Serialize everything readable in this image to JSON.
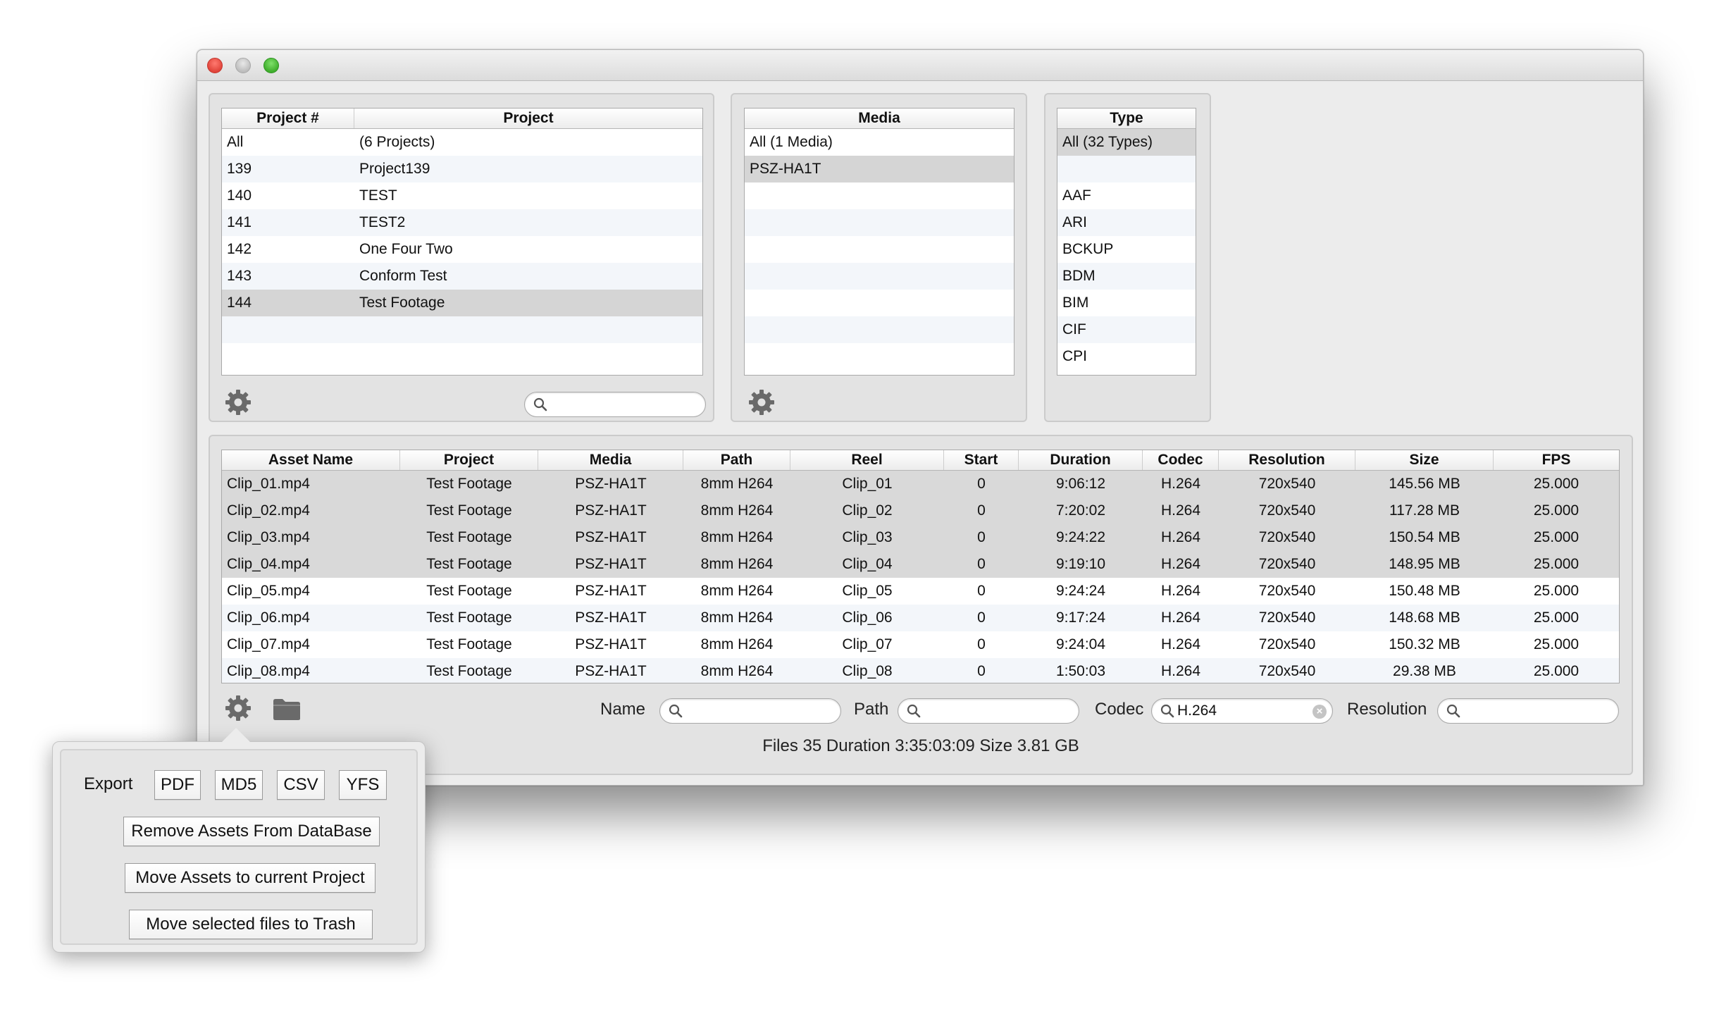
{
  "projects": {
    "columns": [
      "Project #",
      "Project"
    ],
    "rows": [
      {
        "num": "All",
        "name": "(6 Projects)"
      },
      {
        "num": "139",
        "name": "Project139"
      },
      {
        "num": "140",
        "name": "TEST"
      },
      {
        "num": "141",
        "name": "TEST2"
      },
      {
        "num": "142",
        "name": "One Four Two"
      },
      {
        "num": "143",
        "name": "Conform Test"
      },
      {
        "num": "144",
        "name": "Test Footage"
      }
    ],
    "selected_index": 6,
    "search_placeholder": ""
  },
  "media": {
    "column": "Media",
    "rows": [
      "All (1 Media)",
      "PSZ-HA1T"
    ],
    "selected_index": 1
  },
  "types": {
    "column": "Type",
    "rows": [
      "All (32 Types)",
      "",
      "AAF",
      "ARI",
      "BCKUP",
      "BDM",
      "BIM",
      "CIF",
      "CPI"
    ],
    "selected_index": 0
  },
  "assets": {
    "columns": [
      "Asset Name",
      "Project",
      "Media",
      "Path",
      "Reel",
      "Start",
      "Duration",
      "Codec",
      "Resolution",
      "Size",
      "FPS"
    ],
    "rows": [
      [
        "Clip_01.mp4",
        "Test Footage",
        "PSZ-HA1T",
        "8mm H264",
        "Clip_01",
        "0",
        "9:06:12",
        "H.264",
        "720x540",
        "145.56 MB",
        "25.000"
      ],
      [
        "Clip_02.mp4",
        "Test Footage",
        "PSZ-HA1T",
        "8mm H264",
        "Clip_02",
        "0",
        "7:20:02",
        "H.264",
        "720x540",
        "117.28 MB",
        "25.000"
      ],
      [
        "Clip_03.mp4",
        "Test Footage",
        "PSZ-HA1T",
        "8mm H264",
        "Clip_03",
        "0",
        "9:24:22",
        "H.264",
        "720x540",
        "150.54 MB",
        "25.000"
      ],
      [
        "Clip_04.mp4",
        "Test Footage",
        "PSZ-HA1T",
        "8mm H264",
        "Clip_04",
        "0",
        "9:19:10",
        "H.264",
        "720x540",
        "148.95 MB",
        "25.000"
      ],
      [
        "Clip_05.mp4",
        "Test Footage",
        "PSZ-HA1T",
        "8mm H264",
        "Clip_05",
        "0",
        "9:24:24",
        "H.264",
        "720x540",
        "150.48 MB",
        "25.000"
      ],
      [
        "Clip_06.mp4",
        "Test Footage",
        "PSZ-HA1T",
        "8mm H264",
        "Clip_06",
        "0",
        "9:17:24",
        "H.264",
        "720x540",
        "148.68 MB",
        "25.000"
      ],
      [
        "Clip_07.mp4",
        "Test Footage",
        "PSZ-HA1T",
        "8mm H264",
        "Clip_07",
        "0",
        "9:24:04",
        "H.264",
        "720x540",
        "150.32 MB",
        "25.000"
      ],
      [
        "Clip_08.mp4",
        "Test Footage",
        "PSZ-HA1T",
        "8mm H264",
        "Clip_08",
        "0",
        "1:50:03",
        "H.264",
        "720x540",
        "29.38 MB",
        "25.000"
      ]
    ],
    "selected_rows": [
      0,
      1,
      2,
      3
    ]
  },
  "filters": {
    "name_label": "Name",
    "path_label": "Path",
    "codec_label": "Codec",
    "codec_value": "H.264",
    "resolution_label": "Resolution"
  },
  "status": "Files 35 Duration 3:35:03:09 Size 3.81 GB",
  "popover": {
    "export_label": "Export",
    "export_buttons": [
      "PDF",
      "MD5",
      "CSV",
      "YFS"
    ],
    "remove_label": "Remove Assets From DataBase",
    "move_project_label": "Move Assets to current Project",
    "trash_label": "Move selected files to Trash"
  },
  "icons": [
    "close-button",
    "minimize-button",
    "zoom-button",
    "gear-icon",
    "search-icon",
    "folder-icon",
    "clear-icon"
  ]
}
